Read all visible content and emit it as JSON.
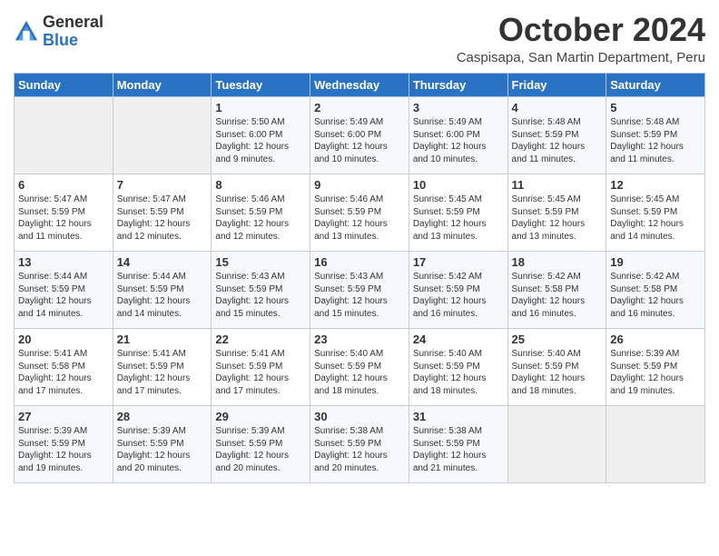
{
  "header": {
    "logo_general": "General",
    "logo_blue": "Blue",
    "month_title": "October 2024",
    "location": "Caspisapa, San Martin Department, Peru"
  },
  "days_of_week": [
    "Sunday",
    "Monday",
    "Tuesday",
    "Wednesday",
    "Thursday",
    "Friday",
    "Saturday"
  ],
  "weeks": [
    [
      {
        "day": "",
        "detail": ""
      },
      {
        "day": "",
        "detail": ""
      },
      {
        "day": "1",
        "detail": "Sunrise: 5:50 AM\nSunset: 6:00 PM\nDaylight: 12 hours\nand 9 minutes."
      },
      {
        "day": "2",
        "detail": "Sunrise: 5:49 AM\nSunset: 6:00 PM\nDaylight: 12 hours\nand 10 minutes."
      },
      {
        "day": "3",
        "detail": "Sunrise: 5:49 AM\nSunset: 6:00 PM\nDaylight: 12 hours\nand 10 minutes."
      },
      {
        "day": "4",
        "detail": "Sunrise: 5:48 AM\nSunset: 5:59 PM\nDaylight: 12 hours\nand 11 minutes."
      },
      {
        "day": "5",
        "detail": "Sunrise: 5:48 AM\nSunset: 5:59 PM\nDaylight: 12 hours\nand 11 minutes."
      }
    ],
    [
      {
        "day": "6",
        "detail": "Sunrise: 5:47 AM\nSunset: 5:59 PM\nDaylight: 12 hours\nand 11 minutes."
      },
      {
        "day": "7",
        "detail": "Sunrise: 5:47 AM\nSunset: 5:59 PM\nDaylight: 12 hours\nand 12 minutes."
      },
      {
        "day": "8",
        "detail": "Sunrise: 5:46 AM\nSunset: 5:59 PM\nDaylight: 12 hours\nand 12 minutes."
      },
      {
        "day": "9",
        "detail": "Sunrise: 5:46 AM\nSunset: 5:59 PM\nDaylight: 12 hours\nand 13 minutes."
      },
      {
        "day": "10",
        "detail": "Sunrise: 5:45 AM\nSunset: 5:59 PM\nDaylight: 12 hours\nand 13 minutes."
      },
      {
        "day": "11",
        "detail": "Sunrise: 5:45 AM\nSunset: 5:59 PM\nDaylight: 12 hours\nand 13 minutes."
      },
      {
        "day": "12",
        "detail": "Sunrise: 5:45 AM\nSunset: 5:59 PM\nDaylight: 12 hours\nand 14 minutes."
      }
    ],
    [
      {
        "day": "13",
        "detail": "Sunrise: 5:44 AM\nSunset: 5:59 PM\nDaylight: 12 hours\nand 14 minutes."
      },
      {
        "day": "14",
        "detail": "Sunrise: 5:44 AM\nSunset: 5:59 PM\nDaylight: 12 hours\nand 14 minutes."
      },
      {
        "day": "15",
        "detail": "Sunrise: 5:43 AM\nSunset: 5:59 PM\nDaylight: 12 hours\nand 15 minutes."
      },
      {
        "day": "16",
        "detail": "Sunrise: 5:43 AM\nSunset: 5:59 PM\nDaylight: 12 hours\nand 15 minutes."
      },
      {
        "day": "17",
        "detail": "Sunrise: 5:42 AM\nSunset: 5:59 PM\nDaylight: 12 hours\nand 16 minutes."
      },
      {
        "day": "18",
        "detail": "Sunrise: 5:42 AM\nSunset: 5:58 PM\nDaylight: 12 hours\nand 16 minutes."
      },
      {
        "day": "19",
        "detail": "Sunrise: 5:42 AM\nSunset: 5:58 PM\nDaylight: 12 hours\nand 16 minutes."
      }
    ],
    [
      {
        "day": "20",
        "detail": "Sunrise: 5:41 AM\nSunset: 5:58 PM\nDaylight: 12 hours\nand 17 minutes."
      },
      {
        "day": "21",
        "detail": "Sunrise: 5:41 AM\nSunset: 5:59 PM\nDaylight: 12 hours\nand 17 minutes."
      },
      {
        "day": "22",
        "detail": "Sunrise: 5:41 AM\nSunset: 5:59 PM\nDaylight: 12 hours\nand 17 minutes."
      },
      {
        "day": "23",
        "detail": "Sunrise: 5:40 AM\nSunset: 5:59 PM\nDaylight: 12 hours\nand 18 minutes."
      },
      {
        "day": "24",
        "detail": "Sunrise: 5:40 AM\nSunset: 5:59 PM\nDaylight: 12 hours\nand 18 minutes."
      },
      {
        "day": "25",
        "detail": "Sunrise: 5:40 AM\nSunset: 5:59 PM\nDaylight: 12 hours\nand 18 minutes."
      },
      {
        "day": "26",
        "detail": "Sunrise: 5:39 AM\nSunset: 5:59 PM\nDaylight: 12 hours\nand 19 minutes."
      }
    ],
    [
      {
        "day": "27",
        "detail": "Sunrise: 5:39 AM\nSunset: 5:59 PM\nDaylight: 12 hours\nand 19 minutes."
      },
      {
        "day": "28",
        "detail": "Sunrise: 5:39 AM\nSunset: 5:59 PM\nDaylight: 12 hours\nand 20 minutes."
      },
      {
        "day": "29",
        "detail": "Sunrise: 5:39 AM\nSunset: 5:59 PM\nDaylight: 12 hours\nand 20 minutes."
      },
      {
        "day": "30",
        "detail": "Sunrise: 5:38 AM\nSunset: 5:59 PM\nDaylight: 12 hours\nand 20 minutes."
      },
      {
        "day": "31",
        "detail": "Sunrise: 5:38 AM\nSunset: 5:59 PM\nDaylight: 12 hours\nand 21 minutes."
      },
      {
        "day": "",
        "detail": ""
      },
      {
        "day": "",
        "detail": ""
      }
    ]
  ]
}
